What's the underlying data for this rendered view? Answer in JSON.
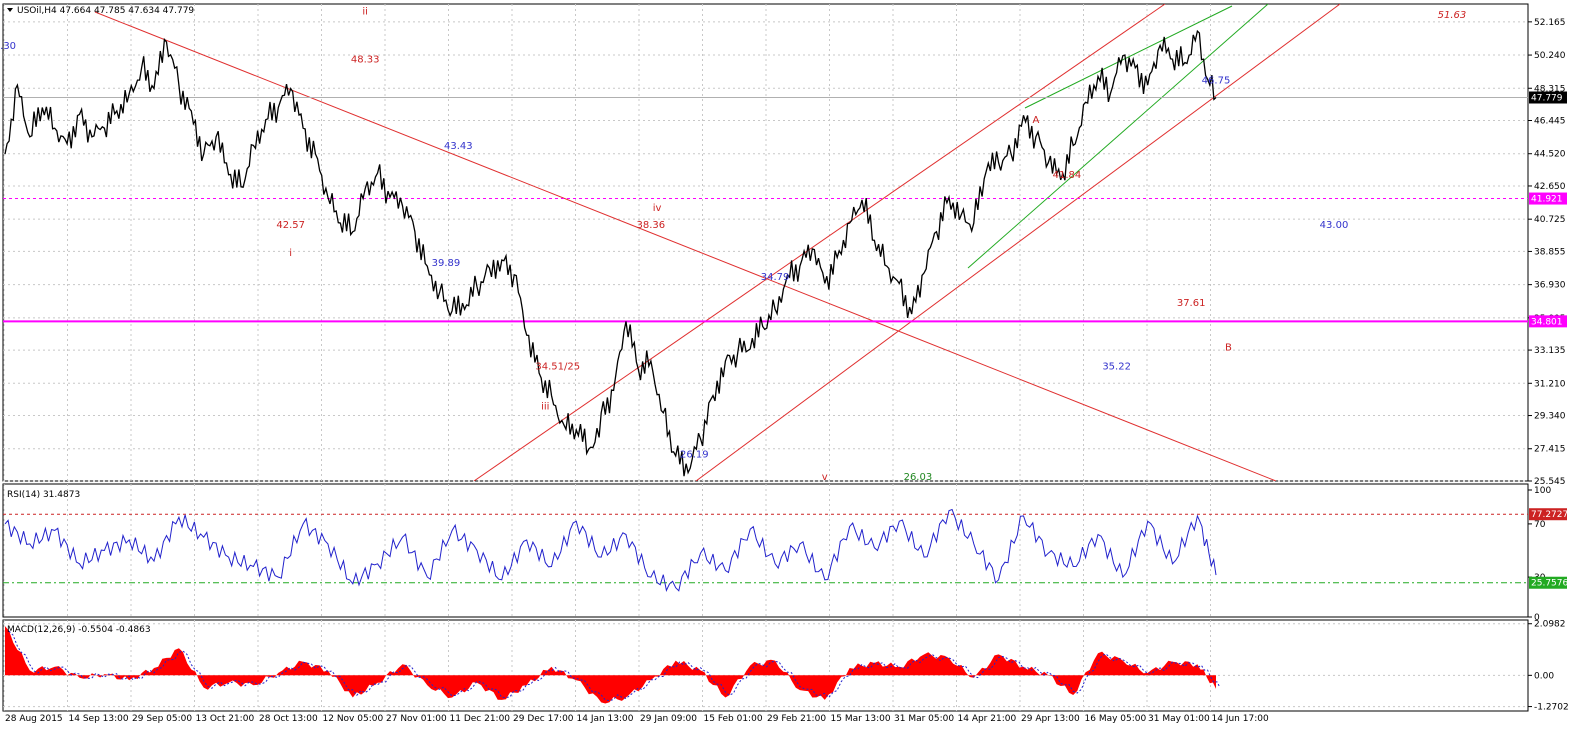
{
  "chart_data": [
    {
      "type": "line",
      "header": "USOil,H4  47.664 47.785 47.634 47.779",
      "y_ticks": [
        "52.165",
        "50.240",
        "48.315",
        "46.445",
        "44.520",
        "42.650",
        "40.725",
        "38.855",
        "36.930",
        "35.005",
        "33.135",
        "31.210",
        "29.340",
        "27.415",
        "25.545"
      ],
      "ylim": [
        25.545,
        53.2
      ],
      "x_ticks": [
        "28 Aug 2015",
        "14 Sep 13:00",
        "29 Sep 05:00",
        "13 Oct 21:00",
        "28 Oct 13:00",
        "12 Nov 05:00",
        "27 Nov 01:00",
        "11 Dec 21:00",
        "29 Dec 17:00",
        "14 Jan 13:00",
        "29 Jan 09:00",
        "15 Feb 01:00",
        "29 Feb 21:00",
        "15 Mar 13:00",
        "31 Mar 05:00",
        "14 Apr 21:00",
        "29 Apr 13:00",
        "16 May 05:00",
        "31 May 01:00",
        "14 Jun 17:00"
      ],
      "series": [
        {
          "name": "USOil,H4",
          "x": [
            0,
            2,
            4,
            6,
            8,
            10,
            12,
            14,
            16,
            18,
            20,
            22,
            24,
            26,
            28,
            30,
            32,
            34,
            36,
            38,
            40,
            42,
            44,
            46,
            48,
            50,
            52,
            54,
            56,
            58,
            60,
            62,
            64,
            66,
            68,
            70,
            72,
            74,
            76,
            78,
            80,
            82,
            84,
            86,
            88,
            90,
            92,
            94,
            95,
            96,
            98,
            100,
            102,
            104,
            106,
            108,
            110,
            112,
            114,
            116,
            118,
            120,
            122,
            124,
            126,
            128,
            130,
            132,
            134,
            136,
            138,
            140,
            142,
            144,
            146,
            148,
            150,
            152,
            154,
            156,
            158,
            160,
            162,
            164,
            166,
            168,
            170,
            172,
            174,
            176,
            178,
            180,
            182,
            184,
            186,
            188,
            190,
            192,
            194,
            195
          ],
          "values": [
            44.5,
            48.5,
            45.5,
            47.2,
            46.0,
            45.1,
            46.8,
            45.5,
            46.0,
            47.0,
            48.0,
            49.5,
            48.3,
            51.0,
            48.5,
            47.0,
            44.5,
            45.5,
            43.3,
            42.6,
            45.0,
            46.5,
            47.2,
            48.3,
            46.0,
            44.5,
            42.0,
            40.5,
            40.0,
            42.5,
            43.4,
            42.0,
            41.5,
            40.0,
            38.0,
            36.5,
            35.4,
            35.5,
            36.8,
            37.9,
            38.36,
            37.5,
            34.0,
            31.8,
            30.5,
            28.8,
            28.5,
            27.4,
            27.8,
            29.5,
            30.8,
            34.8,
            32.0,
            32.5,
            29.5,
            27.0,
            26.03,
            28.0,
            30.5,
            32.5,
            33.0,
            33.2,
            34.5,
            35.5,
            37.5,
            38.0,
            39.0,
            37.0,
            38.5,
            40.5,
            41.84,
            39.5,
            38.0,
            37.0,
            35.22,
            37.61,
            40.0,
            42.0,
            41.0,
            40.5,
            43.5,
            44.0,
            44.5,
            46.75,
            45.5,
            44.0,
            43.0,
            45.0,
            47.5,
            49.0,
            48.0,
            50.2,
            49.5,
            48.5,
            50.8,
            50.0,
            49.8,
            51.63,
            48.5,
            47.779
          ]
        }
      ],
      "price_labels": [
        {
          "text": "47.779",
          "kind": "current",
          "color": "#000000"
        },
        {
          "text": "41.921",
          "kind": "level",
          "color": "#ff00ff"
        },
        {
          "text": "34.801",
          "kind": "level",
          "color": "#ff00ff"
        }
      ],
      "annotations": [
        {
          "text": ".30",
          "color": "#3333cc",
          "x": 0.5,
          "y": 50.6
        },
        {
          "text": "ii",
          "color": "#cc2222",
          "x": 58,
          "y": 52.6
        },
        {
          "text": "48.33",
          "color": "#cc2222",
          "x": 58,
          "y": 49.8
        },
        {
          "text": "42.57",
          "color": "#cc2222",
          "x": 46,
          "y": 40.2
        },
        {
          "text": "i",
          "color": "#cc2222",
          "x": 46,
          "y": 38.6
        },
        {
          "text": "43.43",
          "color": "#3333cc",
          "x": 73,
          "y": 44.8
        },
        {
          "text": "39.89",
          "color": "#3333cc",
          "x": 71,
          "y": 38.0
        },
        {
          "text": "iv",
          "color": "#cc2222",
          "x": 105,
          "y": 41.2
        },
        {
          "text": "38.36",
          "color": "#cc2222",
          "x": 104,
          "y": 40.2
        },
        {
          "text": "34.51/25",
          "color": "#cc2222",
          "x": 89,
          "y": 32.0
        },
        {
          "text": "iii",
          "color": "#cc2222",
          "x": 87,
          "y": 29.7
        },
        {
          "text": "34.79",
          "color": "#3333cc",
          "x": 124,
          "y": 37.2
        },
        {
          "text": "26.19",
          "color": "#3333cc",
          "x": 111,
          "y": 26.9
        },
        {
          "text": "v",
          "color": "#cc2222",
          "x": 132,
          "y": 25.6
        },
        {
          "text": "26.03",
          "color": "#228822",
          "x": 147,
          "y": 25.6
        },
        {
          "text": "A",
          "color": "#cc2222",
          "x": 166,
          "y": 46.3
        },
        {
          "text": "41.84",
          "color": "#cc2222",
          "x": 171,
          "y": 43.1
        },
        {
          "text": "46.75",
          "color": "#3333cc",
          "x": 195,
          "y": 48.6
        },
        {
          "text": "51.63",
          "color": "#cc2222",
          "x": 233,
          "y": 52.4
        },
        {
          "text": "43.00",
          "color": "#3333cc",
          "x": 214,
          "y": 40.2
        },
        {
          "text": "37.61",
          "color": "#cc2222",
          "x": 191,
          "y": 35.7
        },
        {
          "text": "B",
          "color": "#cc2222",
          "x": 197,
          "y": 33.1
        },
        {
          "text": "35.22",
          "color": "#3333cc",
          "x": 179,
          "y": 32.0
        }
      ]
    },
    {
      "type": "line",
      "header": "RSI(14) 31.4873",
      "y_ticks": [
        "100",
        "70",
        "30",
        "0"
      ],
      "ylim": [
        0,
        100
      ],
      "levels": [
        {
          "text": "77.2727",
          "value": 77.27
        },
        {
          "text": "25.7576",
          "value": 25.76
        }
      ],
      "series": [
        {
          "name": "RSI(14)",
          "x": [
            0,
            4,
            8,
            12,
            16,
            20,
            24,
            28,
            32,
            36,
            40,
            44,
            48,
            52,
            56,
            60,
            64,
            68,
            72,
            76,
            80,
            84,
            88,
            92,
            96,
            100,
            104,
            108,
            112,
            116,
            120,
            124,
            128,
            132,
            136,
            140,
            144,
            148,
            152,
            156,
            160,
            164,
            168,
            172,
            176,
            180,
            184,
            188,
            192,
            195
          ],
          "values": [
            70,
            55,
            65,
            40,
            50,
            58,
            42,
            75,
            60,
            45,
            38,
            30,
            70,
            55,
            25,
            40,
            60,
            30,
            65,
            50,
            28,
            58,
            38,
            72,
            45,
            62,
            30,
            22,
            48,
            35,
            66,
            40,
            55,
            28,
            68,
            52,
            72,
            45,
            80,
            55,
            28,
            76,
            48,
            38,
            62,
            30,
            72,
            40,
            76,
            31.5
          ]
        }
      ]
    },
    {
      "type": "area",
      "header": "MACD(12,26,9) -0.5504 -0.4863",
      "y_ticks": [
        "2.0982",
        "0.00",
        "-1.2702"
      ],
      "ylim": [
        -1.45,
        2.25
      ],
      "series": [
        {
          "name": "MACD(12,26,9)",
          "x": [
            0,
            4,
            8,
            12,
            16,
            20,
            24,
            28,
            32,
            36,
            40,
            44,
            48,
            52,
            56,
            60,
            64,
            68,
            72,
            76,
            80,
            84,
            88,
            92,
            96,
            100,
            104,
            108,
            112,
            116,
            120,
            124,
            128,
            132,
            136,
            140,
            144,
            148,
            152,
            156,
            160,
            164,
            168,
            172,
            176,
            180,
            184,
            188,
            192,
            195
          ],
          "values": [
            2.0,
            0.2,
            0.35,
            -0.1,
            0.05,
            -0.2,
            0.3,
            1.1,
            -0.5,
            -0.3,
            -0.4,
            0.1,
            0.55,
            0.2,
            -0.9,
            -0.3,
            0.45,
            -0.4,
            -0.9,
            -0.3,
            -1.0,
            -0.4,
            0.35,
            -0.2,
            -1.1,
            -0.9,
            -0.2,
            0.6,
            0.2,
            -0.9,
            0.4,
            0.6,
            -0.6,
            -1.0,
            0.3,
            0.5,
            0.35,
            0.85,
            0.7,
            -0.1,
            0.85,
            0.35,
            0.0,
            -0.8,
            0.9,
            0.6,
            0.1,
            0.55,
            0.45,
            -0.55
          ]
        }
      ]
    }
  ]
}
